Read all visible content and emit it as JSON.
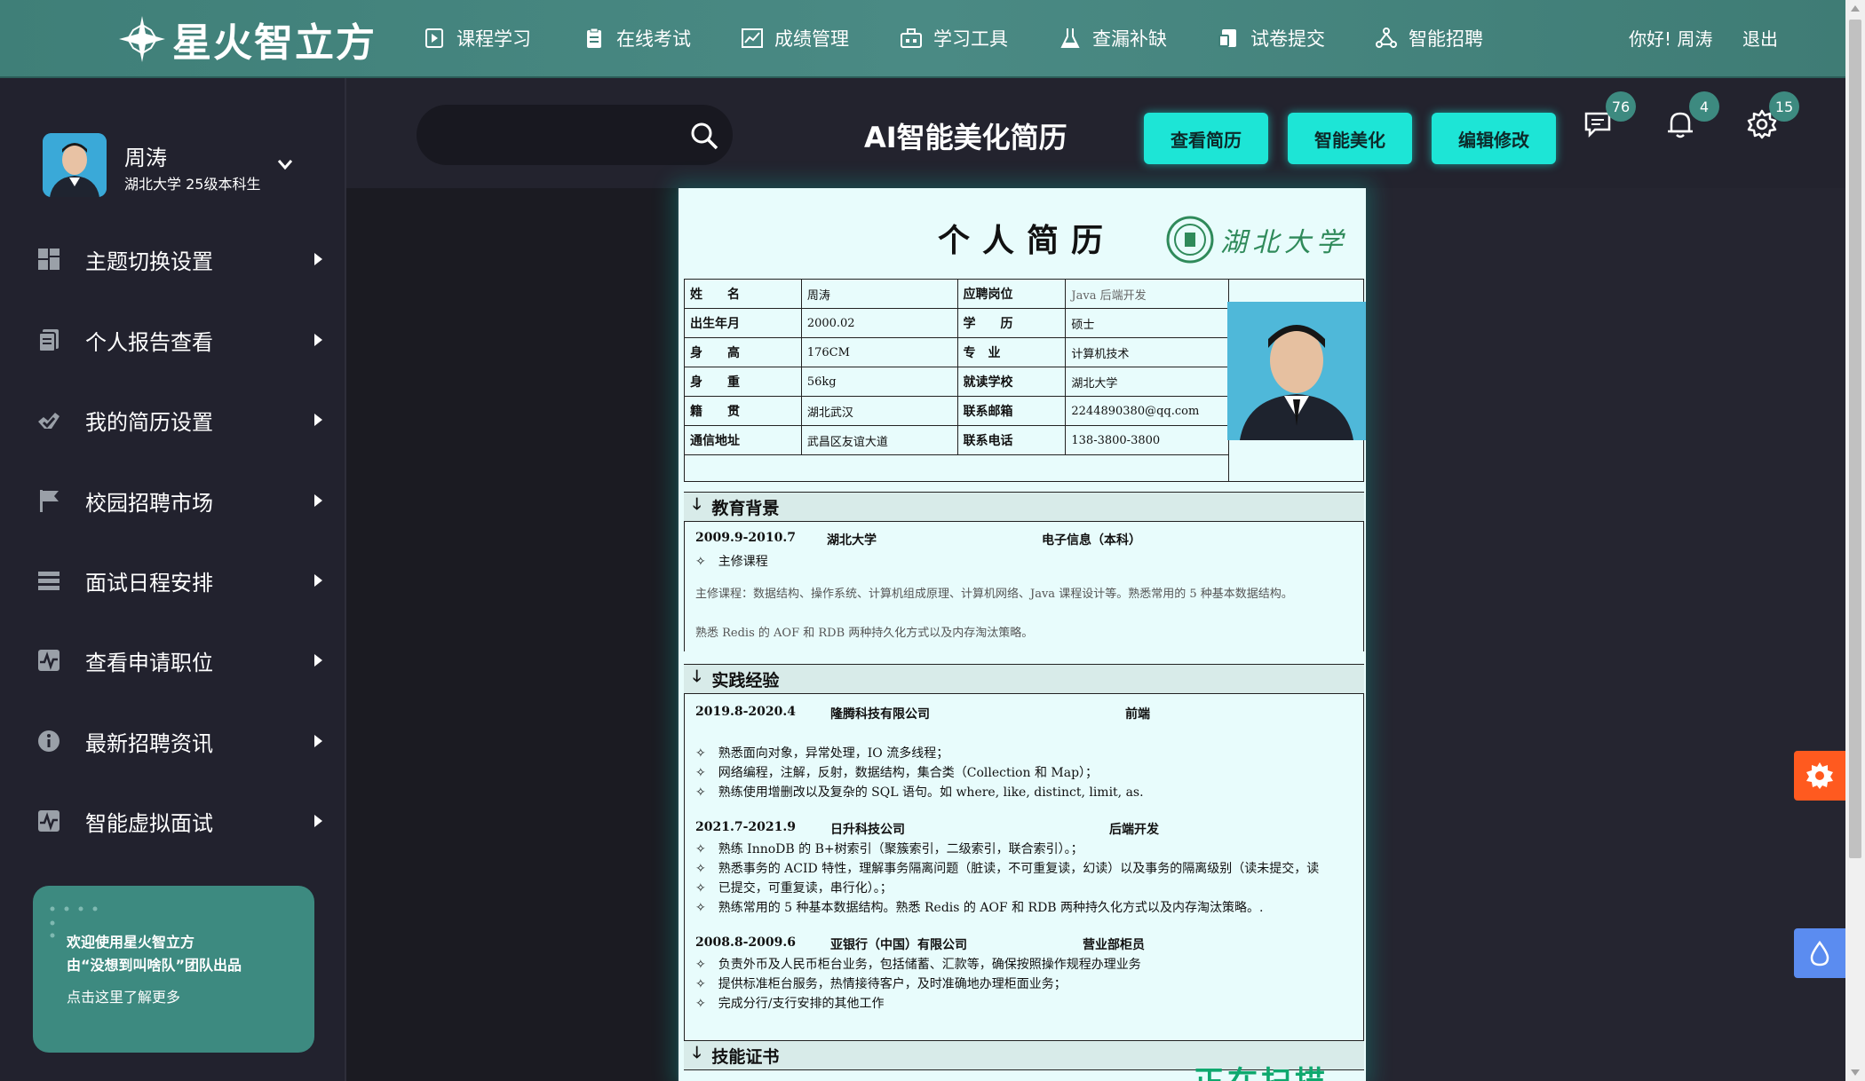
{
  "brand": {
    "name": "星火智立方"
  },
  "nav": {
    "items": [
      {
        "label": "课程学习",
        "icon": "play-doc-icon"
      },
      {
        "label": "在线考试",
        "icon": "clipboard-icon"
      },
      {
        "label": "成绩管理",
        "icon": "chart-icon"
      },
      {
        "label": "学习工具",
        "icon": "toolbox-icon"
      },
      {
        "label": "查漏补缺",
        "icon": "flask-icon"
      },
      {
        "label": "试卷提交",
        "icon": "submit-icon"
      },
      {
        "label": "智能招聘",
        "icon": "network-icon"
      }
    ],
    "greeting": "你好! 周涛",
    "logout": "退出"
  },
  "profile": {
    "name": "周涛",
    "sub": "湖北大学 25级本科生"
  },
  "sidebar": {
    "items": [
      {
        "label": "主题切换设置",
        "icon": "grid-icon"
      },
      {
        "label": "个人报告查看",
        "icon": "report-icon"
      },
      {
        "label": "我的简历设置",
        "icon": "resume-icon"
      },
      {
        "label": "校园招聘市场",
        "icon": "flag-icon"
      },
      {
        "label": "面试日程安排",
        "icon": "list-icon"
      },
      {
        "label": "查看申请职位",
        "icon": "pulse-icon"
      },
      {
        "label": "最新招聘资讯",
        "icon": "info-icon"
      },
      {
        "label": "智能虚拟面试",
        "icon": "pulse-icon"
      }
    ]
  },
  "promo": {
    "line1": "欢迎使用星火智立方",
    "line2": "由“没想到叫啥队”团队出品",
    "link": "点击这里了解更多"
  },
  "toolbar": {
    "search_placeholder": "",
    "title": "AI智能美化简历",
    "buttons": [
      "查看简历",
      "智能美化",
      "编辑修改"
    ],
    "badges": {
      "messages": "76",
      "notifications": "4",
      "settings": "15"
    }
  },
  "resume": {
    "title": "个人简历",
    "university": "湖北大学",
    "info": [
      {
        "l1": "姓　　名",
        "v1": "周涛",
        "l2": "应聘岗位",
        "v2": "Java 后端开发"
      },
      {
        "l1": "出生年月",
        "v1": "2000.02",
        "l2": "学　　历",
        "v2": "硕士"
      },
      {
        "l1": "身　　高",
        "v1": "176CM",
        "l2": "专　业",
        "v2": "计算机技术"
      },
      {
        "l1": "身　　重",
        "v1": "56kg",
        "l2": "就读学校",
        "v2": "湖北大学"
      },
      {
        "l1": "籍　　贯",
        "v1": "湖北武汉",
        "l2": "联系邮箱",
        "v2": "2244890380@qq.com"
      },
      {
        "l1": "通信地址",
        "v1": "武昌区友谊大道",
        "l2": "联系电话",
        "v2": "138-3800-3800"
      }
    ],
    "edu": {
      "heading": "教育背景",
      "period": "2009.9-2010.7",
      "school": "湖北大学",
      "major": "电子信息（本科）",
      "courses_label": "主修课程",
      "courses": "主修课程：数据结构、操作系统、计算机组成原理、计算机网络、Java 课程设计等。熟悉常用的 5 种基本数据结构。",
      "extra": "熟悉 Redis 的 AOF 和 RDB 两种持久化方式以及内存淘汰策略。"
    },
    "exp": {
      "heading": "实践经验",
      "jobs": [
        {
          "period": "2019.8-2020.4",
          "company": "隆腾科技有限公司",
          "role": "前端",
          "points": [
            "熟悉面向对象，异常处理，IO 流多线程；",
            "网络编程，注解，反射，数据结构，集合类（Collection 和 Map）；",
            "熟练使用增删改以及复杂的 SQL 语句。如 where, like, distinct, limit, as."
          ]
        },
        {
          "period": "2021.7-2021.9",
          "company": "日升科技公司",
          "role": "后端开发",
          "points": [
            "熟练 InnoDB 的 B+树索引（聚簇索引，二级索引，联合索引）。；",
            "熟悉事务的 ACID 特性，理解事务隔离问题（脏读，不可重复读，幻读）以及事务的隔离级别（读未提交，读",
            "已提交，可重复读，串行化）。；",
            "熟练常用的 5 种基本数据结构。熟悉 Redis 的 AOF 和 RDB 两种持久化方式以及内存淘汰策略。."
          ]
        },
        {
          "period": "2008.8-2009.6",
          "company": "亚银行（中国）有限公司",
          "role": "营业部柜员",
          "points": [
            "负责外币及人民币柜台业务，包括储蓄、汇款等，确保按照操作规程办理业务",
            "提供标准柜台服务，热情接待客户，及时准确地办理柜面业务；",
            "完成分行/支行安排的其他工作"
          ]
        }
      ]
    },
    "skills": {
      "heading": "技能证书"
    },
    "scan_text": "正在扫描"
  }
}
